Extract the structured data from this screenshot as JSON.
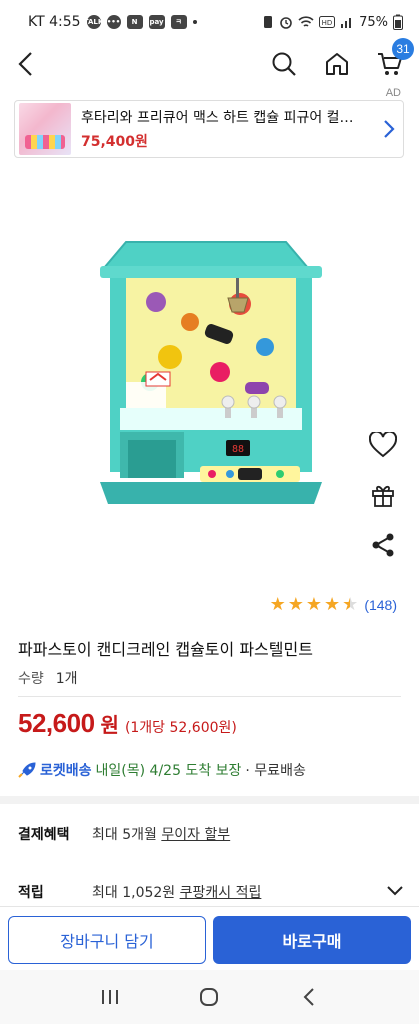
{
  "status_bar": {
    "carrier_time": "KT 4:55",
    "notif_icons": [
      "TALK",
      "N",
      "pay",
      "ㅋ"
    ],
    "battery": "75%"
  },
  "top_nav": {
    "cart_count": "31",
    "ad_label": "AD"
  },
  "ad_banner": {
    "title": "후타리와 프리큐어 맥스 하트 캡슐 피규어 컬렉...",
    "price": "75,400원"
  },
  "product": {
    "rating_value": 4.5,
    "rating_count": "(148)",
    "title": "파파스토이 캔디크레인 캡슐토이 파스텔민트",
    "qty_label": "수량",
    "qty_value": "1개",
    "price": "52,600",
    "price_unit": "원",
    "unit_price": "(1개당 52,600원)",
    "delivery": {
      "rocket_label": "로켓배송",
      "date": "내일(목) 4/25 도착 보장",
      "free": "· 무료배송"
    }
  },
  "benefits": {
    "payment_label": "결제혜택",
    "payment_prefix": "최대 5개월 ",
    "payment_link": "무이자 할부",
    "points_label": "적립",
    "points_prefix": "최대 1,052원 ",
    "points_link": "쿠팡캐시 적립"
  },
  "actions": {
    "cart_button": "장바구니 담기",
    "buy_button": "바로구매"
  },
  "colors": {
    "accent_blue": "#2a62d6",
    "price_red": "#c61a1a",
    "star": "#f5a623",
    "mint": "#4fd1c5"
  }
}
